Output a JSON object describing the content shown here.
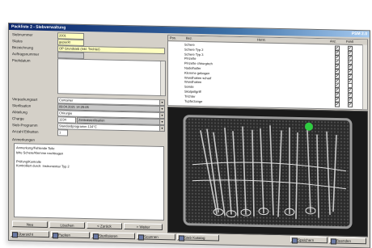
{
  "window": {
    "title": "Packliste 2 - Siebverwaltung",
    "title_right": "PSM 2.0"
  },
  "form": {
    "fields": [
      {
        "label": "Siebnummer",
        "value": "2001",
        "style": "yellow"
      },
      {
        "label": "Status",
        "value": "gepackt",
        "style": "yellow"
      },
      {
        "label": "Bezeichnung",
        "value": "OP Grundsieb (inkl. Trichter)",
        "style": "yellow"
      },
      {
        "label": "Auftragsnummer",
        "value": "",
        "style": "gray"
      },
      {
        "label": "Packdatum",
        "value": "",
        "style": "white"
      }
    ],
    "lower_fields": [
      {
        "label": "Verpackungsart",
        "value": "Container",
        "combo": true
      },
      {
        "label": "Sterilisation",
        "value": "09.04.2021 14:25:05",
        "combo": true
      },
      {
        "label": "Abteilung",
        "value": "Chirurgie",
        "combo": true
      },
      {
        "label": "Charge",
        "value": "1234",
        "value2": "Zentralsterilisation",
        "combo": true
      },
      {
        "label": "Sieb-Programm",
        "value": "Standardprogramm 134°C",
        "combo": true
      },
      {
        "label": "Anzahl Etiketten",
        "value": "1",
        "combo": false
      }
    ],
    "notes_label": "Anmerkungen",
    "notes_lines": [
      "Anmerkung/Fehlende Teile",
      "bitte Schere/Klemme nachtragen",
      "",
      "Prüfung/Kontrolle",
      "Kontrolliert durch: Instrumentar Typ 2"
    ]
  },
  "buttons": {
    "new": "Neu",
    "cancel": "Löschen",
    "prev": "< Zurück",
    "next": "> Weiter"
  },
  "grid": {
    "headers": [
      "Pos.",
      "Bez.",
      "Herst.",
      "Anz.",
      "Fehlt"
    ],
    "rows": [
      {
        "name": "Schere",
        "a": true,
        "b": true
      },
      {
        "name": "Schere Typ 2",
        "a": true,
        "b": true
      },
      {
        "name": "Schere Typ 3",
        "a": true,
        "b": true
      },
      {
        "name": "Pinzette",
        "a": true,
        "b": true
      },
      {
        "name": "Pinzette chirurgisch",
        "a": true,
        "b": true
      },
      {
        "name": "Nadelhalter",
        "a": true,
        "b": true
      },
      {
        "name": "Klemme gebogen",
        "a": true,
        "b": true
      },
      {
        "name": "Wundhaken scharf",
        "a": true,
        "b": true
      },
      {
        "name": "Wundhaken",
        "a": true,
        "b": false
      },
      {
        "name": "Sonde",
        "a": true,
        "b": true
      },
      {
        "name": "Skalpellgriff",
        "a": true,
        "b": true
      },
      {
        "name": "Trichter",
        "a": true,
        "b": true
      },
      {
        "name": "Tupferzange",
        "a": true,
        "b": true
      }
    ]
  },
  "statusbar": {
    "items": [
      "Übersicht",
      "Packen",
      "Sterilisieren",
      "Scannen",
      "Sieb Katalog"
    ],
    "right_items": [
      "Speichern",
      "Beenden"
    ]
  },
  "colors": {
    "accent": "#0a246a",
    "field_yellow": "#ffffc0",
    "green_marker": "#2ecc40"
  }
}
